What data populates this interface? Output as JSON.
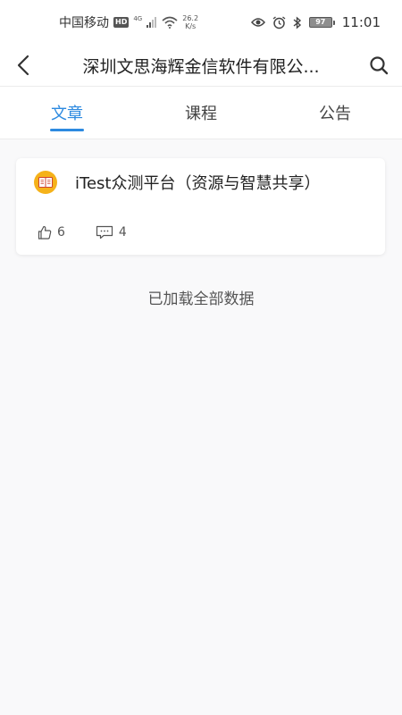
{
  "status_bar": {
    "carrier": "中国移动",
    "hd_badge": "HD",
    "network": "4G",
    "speed_value": "26.2",
    "speed_unit": "K/s",
    "battery": "97",
    "time": "11:01"
  },
  "nav": {
    "title": "深圳文思海辉金信软件有限公...",
    "back_icon": "chevron-left-icon",
    "search_icon": "search-icon"
  },
  "tabs": [
    {
      "label": "文章",
      "active": true
    },
    {
      "label": "课程",
      "active": false
    },
    {
      "label": "公告",
      "active": false
    }
  ],
  "articles": [
    {
      "title": "iTest众测平台（资源与智慧共享）",
      "likes": "6",
      "comments": "4"
    }
  ],
  "footer_text": "已加载全部数据",
  "colors": {
    "accent": "#2d8ae0",
    "avatar": "#f5b21a"
  }
}
